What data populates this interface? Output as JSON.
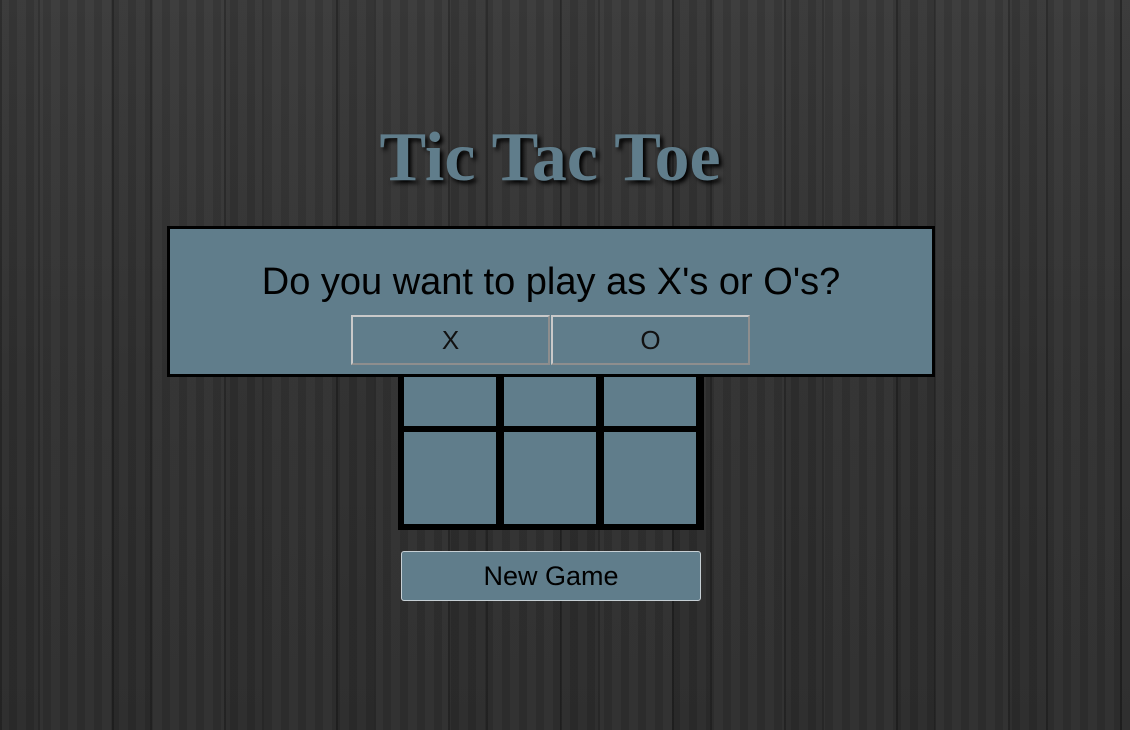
{
  "title": "Tic Tac Toe",
  "prompt": {
    "question": "Do you want to play as X's or O's?",
    "options": [
      "X",
      "O"
    ]
  },
  "board": {
    "cells": [
      "",
      "",
      "",
      "",
      "",
      "",
      "",
      "",
      ""
    ]
  },
  "controls": {
    "new_game_label": "New Game"
  },
  "colors": {
    "panel": "#607d8b",
    "title": "#607d8b",
    "grid_lines": "#000000",
    "background": "#2b2b2b"
  }
}
